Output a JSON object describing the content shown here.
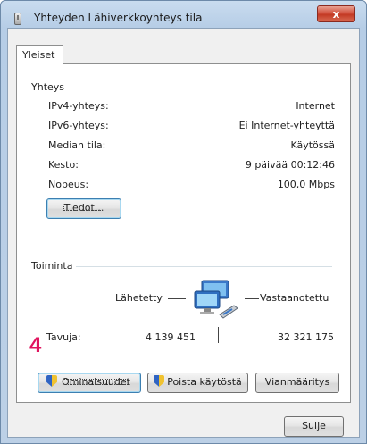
{
  "window": {
    "title": "Yhteyden Lähiverkkoyhteys tila",
    "close_glyph": "x"
  },
  "tabs": [
    {
      "label": "Yleiset"
    }
  ],
  "connection": {
    "group_label": "Yhteys",
    "rows": [
      {
        "label": "IPv4-yhteys:",
        "value": "Internet"
      },
      {
        "label": "IPv6-yhteys:",
        "value": "Ei Internet-yhteyttä"
      },
      {
        "label": "Median tila:",
        "value": "Käytössä"
      },
      {
        "label": "Kesto:",
        "value": "9 päivää 00:12:46"
      },
      {
        "label": "Nopeus:",
        "value": "100,0 Mbps"
      }
    ],
    "details_button": "Tiedot..."
  },
  "activity": {
    "group_label": "Toiminta",
    "sent_label": "Lähetetty",
    "received_label": "Vastaanotettu",
    "bytes_label": "Tavuja:",
    "bytes_sent": "4 139 451",
    "bytes_received": "32 321 175"
  },
  "annotation": {
    "step_number": "4",
    "color": "#e0145f"
  },
  "buttons": {
    "properties": "Ominaisuudet",
    "disable": "Poista käytöstä",
    "diagnose": "Vianmääritys",
    "close": "Sulje"
  },
  "icons": {
    "network": "network-computers-icon",
    "shield": "uac-shield-icon"
  }
}
